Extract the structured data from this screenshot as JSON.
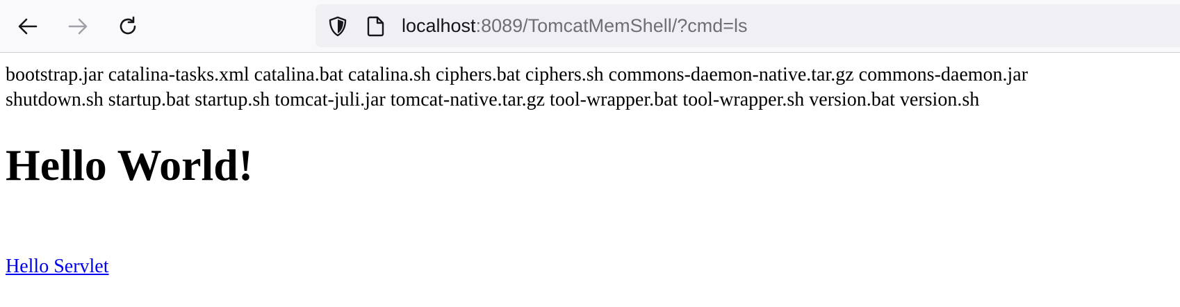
{
  "browser": {
    "url_host": "localhost",
    "url_path": ":8089/TomcatMemShell/?cmd=ls",
    "icons": {
      "back": "arrow-left-icon",
      "forward": "arrow-right-icon",
      "reload": "reload-icon",
      "tracking": "shield-icon",
      "page": "page-icon"
    }
  },
  "page": {
    "listing_line_1": "bootstrap.jar catalina-tasks.xml catalina.bat catalina.sh ciphers.bat ciphers.sh commons-daemon-native.tar.gz commons-daemon.jar",
    "listing_line_2": "shutdown.sh startup.bat startup.sh tomcat-juli.jar tomcat-native.tar.gz tool-wrapper.bat tool-wrapper.sh version.bat version.sh",
    "heading": "Hello World!",
    "link_text": "Hello Servlet",
    "link_color": "#0000ee"
  }
}
